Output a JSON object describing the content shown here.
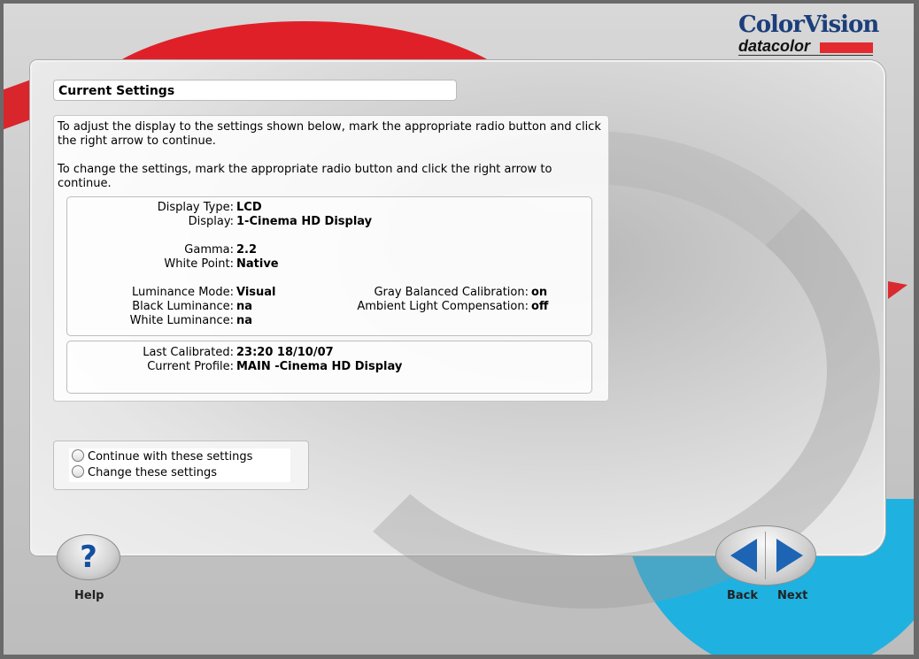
{
  "header": {
    "title": "Current Settings",
    "logo": {
      "brand": "ColorVision",
      "sub": "datacolor"
    }
  },
  "intro": {
    "paragraph1": "To adjust the display to the settings shown below, mark the appropriate radio button and click the right arrow to continue.",
    "paragraph2": "To change the settings, mark the appropriate radio button and click the right arrow to continue."
  },
  "settings": {
    "display_type": {
      "label": "Display Type:",
      "value": "LCD"
    },
    "display": {
      "label": "Display:",
      "value": "1-Cinema HD Display"
    },
    "gamma": {
      "label": "Gamma:",
      "value": "2.2"
    },
    "white_point": {
      "label": "White Point:",
      "value": "Native"
    },
    "luminance_mode": {
      "label": "Luminance Mode:",
      "value": "Visual"
    },
    "black_luminance": {
      "label": "Black Luminance:",
      "value": "na"
    },
    "white_luminance": {
      "label": "White Luminance:",
      "value": "na"
    },
    "gray_balanced": {
      "label": "Gray Balanced Calibration:",
      "value": "on"
    },
    "ambient_light": {
      "label": "Ambient Light Compensation:",
      "value": "off"
    }
  },
  "calibration": {
    "last_calibrated": {
      "label": "Last Calibrated:",
      "value": "23:20 18/10/07"
    },
    "current_profile": {
      "label": "Current Profile:",
      "value": "MAIN -Cinema HD Display"
    }
  },
  "options": {
    "continue_label": "Continue with these settings",
    "change_label": "Change these settings"
  },
  "nav": {
    "help_label": "Help",
    "help_glyph": "?",
    "back_label": "Back",
    "next_label": "Next"
  },
  "colors": {
    "accent_red": "#e02028",
    "accent_cyan": "#1fb1e0",
    "arrow_blue": "#1d64b5",
    "brand_blue": "#1c3f7a"
  },
  "icons": [
    "help-icon",
    "back-arrow-icon",
    "next-arrow-icon"
  ]
}
